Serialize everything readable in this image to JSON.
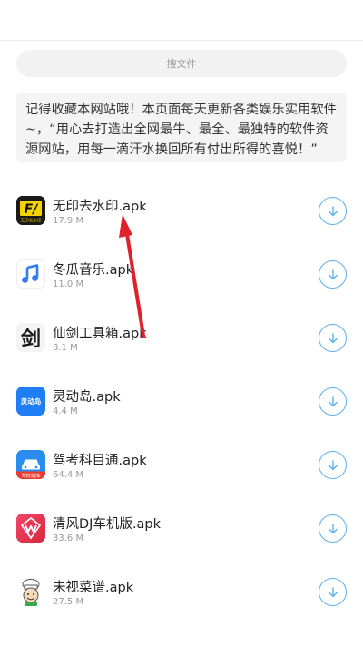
{
  "search": {
    "label": "搜文件"
  },
  "notice": {
    "text": "记得收藏本网站哦！本页面每天更新各类娱乐实用软件~，“用心去打造出全网最牛、最全、最独特的软件资源网站，用每一滴汗水换回所有付出所得的喜悦！”"
  },
  "files": [
    {
      "name": "无印去水印.apk",
      "size": "17.9 M",
      "icon": "watermark-remover-app-icon",
      "icon_label": "无印去水印"
    },
    {
      "name": "冬瓜音乐.apk",
      "size": "11.0 M",
      "icon": "music-note-app-icon"
    },
    {
      "name": "仙剑工具箱.apk",
      "size": "8.1 M",
      "icon": "calligraphy-app-icon",
      "icon_label": "剑"
    },
    {
      "name": "灵动岛.apk",
      "size": "4.4 M",
      "icon": "dynamic-island-app-icon",
      "icon_label": "灵动岛"
    },
    {
      "name": "驾考科目通.apk",
      "size": "64.4 M",
      "icon": "driving-test-app-icon",
      "icon_label": "驾校题库"
    },
    {
      "name": "清风DJ车机版.apk",
      "size": "33.6 M",
      "icon": "dj-app-icon"
    },
    {
      "name": "未视菜谱.apk",
      "size": "27.5 M",
      "icon": "chef-app-icon"
    }
  ],
  "colors": {
    "download_accent": "#5fb0f0",
    "annotation_arrow": "#e0202a"
  }
}
